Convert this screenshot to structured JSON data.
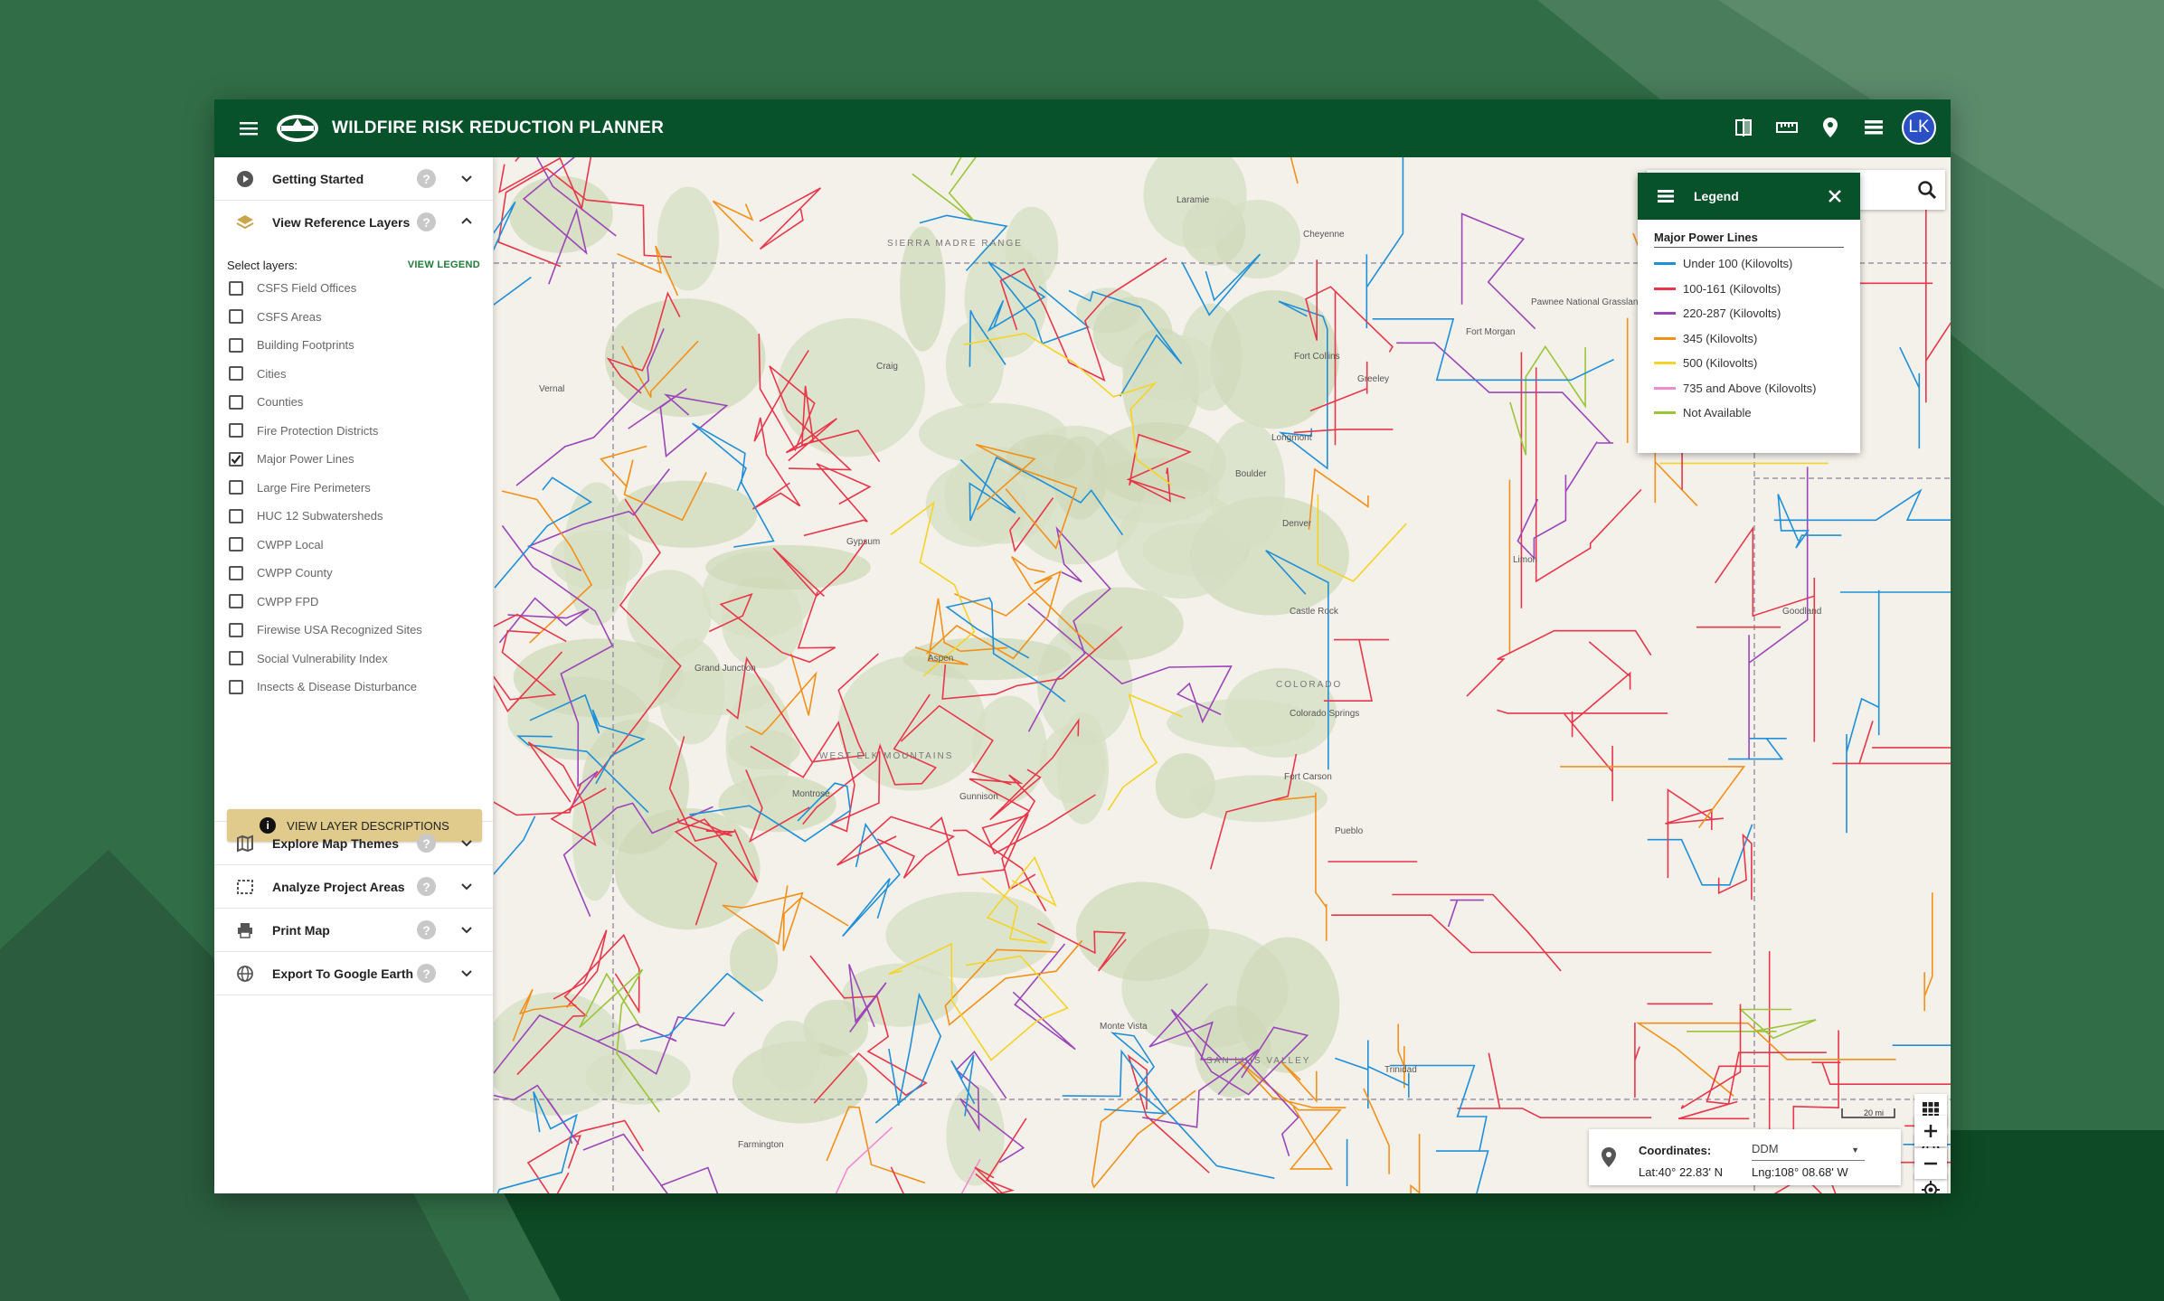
{
  "app": {
    "title": "WILDFIRE RISK REDUCTION PLANNER",
    "user_initials": "LK",
    "brand_color": "#07522a",
    "accent_color": "#e0cb8c"
  },
  "topbar_icons": [
    "compare-icon",
    "ruler-icon",
    "map-pin-icon",
    "layers-list-icon"
  ],
  "sidebar": {
    "getting_started": "Getting Started",
    "view_reference_layers": "View Reference Layers",
    "select_layers_label": "Select layers:",
    "view_legend_link": "VIEW LEGEND",
    "layers": [
      {
        "label": "CSFS Field Offices",
        "checked": false
      },
      {
        "label": "CSFS Areas",
        "checked": false
      },
      {
        "label": "Building Footprints",
        "checked": false
      },
      {
        "label": "Cities",
        "checked": false
      },
      {
        "label": "Counties",
        "checked": false
      },
      {
        "label": "Fire Protection Districts",
        "checked": false
      },
      {
        "label": "Major Power Lines",
        "checked": true
      },
      {
        "label": "Large Fire Perimeters",
        "checked": false
      },
      {
        "label": "HUC 12 Subwatersheds",
        "checked": false
      },
      {
        "label": "CWPP Local",
        "checked": false
      },
      {
        "label": "CWPP County",
        "checked": false
      },
      {
        "label": "CWPP FPD",
        "checked": false
      },
      {
        "label": "Firewise USA Recognized Sites",
        "checked": false
      },
      {
        "label": "Social Vulnerability Index",
        "checked": false
      },
      {
        "label": "Insects & Disease Disturbance",
        "checked": false
      }
    ],
    "view_layer_descriptions": "VIEW LAYER DESCRIPTIONS",
    "explore_map_themes": "Explore Map Themes",
    "analyze_project_areas": "Analyze Project Areas",
    "print_map": "Print Map",
    "export_google_earth": "Export To Google Earth",
    "help_glyph": "?"
  },
  "legend": {
    "title": "Legend",
    "subtitle": "Major Power Lines",
    "items": [
      {
        "label": "Under 100 (Kilovolts)",
        "color": "#1f8fd8"
      },
      {
        "label": "100-161 (Kilovolts)",
        "color": "#e8364a"
      },
      {
        "label": "220-287 (Kilovolts)",
        "color": "#9b46b8"
      },
      {
        "label": "345 (Kilovolts)",
        "color": "#f39019"
      },
      {
        "label": "500 (Kilovolts)",
        "color": "#f5d327"
      },
      {
        "label": "735 and Above (Kilovolts)",
        "color": "#f28ad2"
      },
      {
        "label": "Not Available",
        "color": "#9bc43b"
      }
    ]
  },
  "coordinates": {
    "label": "Coordinates:",
    "format": "DDM",
    "lat": "Lat:40° 22.83' N",
    "lng": "Lng:108° 08.68' W"
  },
  "scale_label": "20 mi",
  "map_labels": [
    {
      "text": "Cheyenne"
    },
    {
      "text": "Laramie"
    },
    {
      "text": "Fort Collins"
    },
    {
      "text": "Greeley"
    },
    {
      "text": "Boulder"
    },
    {
      "text": "Longmont"
    },
    {
      "text": "Denver"
    },
    {
      "text": "Castle Rock"
    },
    {
      "text": "Colorado Springs"
    },
    {
      "text": "Pueblo"
    },
    {
      "text": "Fort Morgan"
    },
    {
      "text": "Goodland"
    },
    {
      "text": "Grand Junction"
    },
    {
      "text": "Montrose"
    },
    {
      "text": "Gunnison"
    },
    {
      "text": "Aspen"
    },
    {
      "text": "Gypsum"
    },
    {
      "text": "Craig"
    },
    {
      "text": "Vernal"
    },
    {
      "text": "Trinidad"
    },
    {
      "text": "Farmington"
    },
    {
      "text": "Monte Vista"
    },
    {
      "text": "COLORADO"
    },
    {
      "text": "WEST ELK MOUNTAINS"
    },
    {
      "text": "SAN LUIS VALLEY"
    },
    {
      "text": "SIERRA MADRE RANGE"
    },
    {
      "text": "Fort Carson"
    },
    {
      "text": "Pawnee National Grassland"
    },
    {
      "text": "Limon"
    }
  ]
}
